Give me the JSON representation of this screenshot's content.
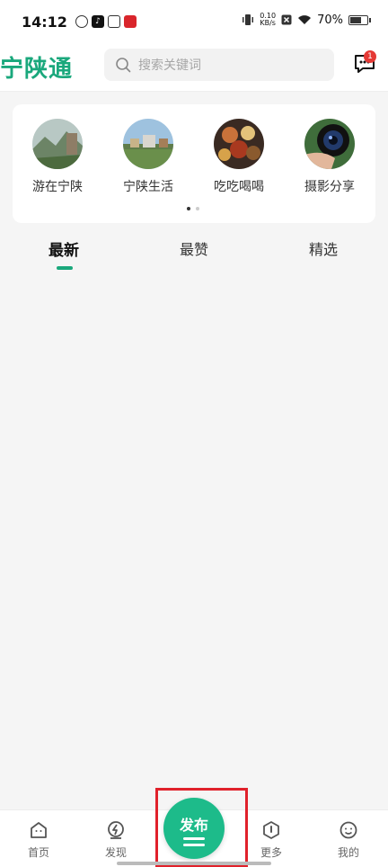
{
  "status": {
    "time": "14:12",
    "net_speed_top": "0.10",
    "net_speed_bottom": "KB/s",
    "battery": "70%",
    "battery_level": 0.7
  },
  "header": {
    "logo": "宁陕通",
    "search_placeholder": "搜索关键词",
    "message_badge": "1"
  },
  "categories": [
    {
      "label": "游在宁陕",
      "icon": "mountain-photo"
    },
    {
      "label": "宁陕生活",
      "icon": "town-photo"
    },
    {
      "label": "吃吃喝喝",
      "icon": "food-photo"
    },
    {
      "label": "摄影分享",
      "icon": "camera-photo"
    }
  ],
  "tabs": [
    {
      "label": "最新"
    },
    {
      "label": "最赞"
    },
    {
      "label": "精选"
    }
  ],
  "bottom_nav": {
    "home": "首页",
    "discover": "发现",
    "publish": "发布",
    "more": "更多",
    "mine": "我的"
  },
  "colors": {
    "accent": "#1aa87c",
    "publish": "#1dbb8a",
    "highlight": "#e0212b"
  }
}
